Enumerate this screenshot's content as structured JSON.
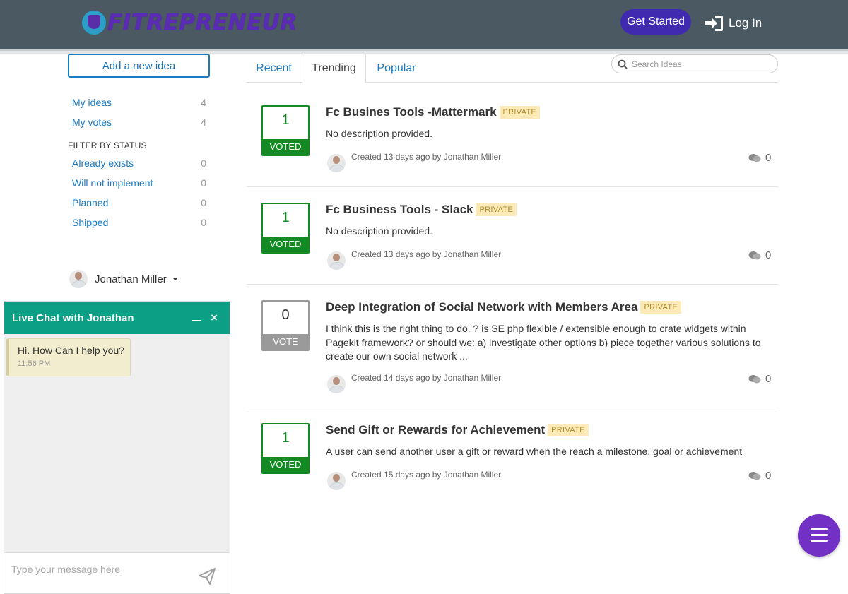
{
  "header": {
    "logo_text": "FITREPRENEUR",
    "get_started": "Get Started",
    "login": "Log In",
    "colors": {
      "bar": "#4b5962",
      "accent": "#3f2ab0"
    }
  },
  "sidebar": {
    "add_idea": "Add a new idea",
    "links": [
      {
        "label": "My ideas",
        "count": "4"
      },
      {
        "label": "My votes",
        "count": "4"
      }
    ],
    "filter_title": "FILTER BY STATUS",
    "statuses": [
      {
        "label": "Already exists",
        "count": "0"
      },
      {
        "label": "Will not implement",
        "count": "0"
      },
      {
        "label": "Planned",
        "count": "0"
      },
      {
        "label": "Shipped",
        "count": "0"
      }
    ],
    "user_name": "Jonathan Miller"
  },
  "chat": {
    "title": "Live Chat with Jonathan",
    "minimize_icon": "minimize-icon",
    "close_icon": "×",
    "message": "Hi. How Can I help you?",
    "time": "11:56 PM",
    "input_placeholder": "Type your message here",
    "color": "#0d9e86"
  },
  "tabs": [
    {
      "label": "Recent",
      "active": false
    },
    {
      "label": "Trending",
      "active": true
    },
    {
      "label": "Popular",
      "active": false
    }
  ],
  "search": {
    "placeholder": "Search Ideas"
  },
  "ideas": [
    {
      "votes": "1",
      "vote_label": "VOTED",
      "title": "Fc Busines Tools -Mattermark",
      "badge": "PRIVATE",
      "description": "No description provided.",
      "meta": "Created 13 days ago by Jonathan Miller",
      "comments": "0"
    },
    {
      "votes": "1",
      "vote_label": "VOTED",
      "title": "Fc Business Tools - Slack",
      "badge": "PRIVATE",
      "description": "No description provided.",
      "meta": "Created 13 days ago by Jonathan Miller",
      "comments": "0"
    },
    {
      "votes": "0",
      "vote_label": "VOTE",
      "title": "Deep Integration of Social Network with Members Area",
      "badge": "PRIVATE",
      "description": "I think this is the right thing to do. ? is SE php flexible / extensible enough to crate widgets within Pagekit framework? or should we: a) investigate other options b) piece together various solutions to create our own social network ...",
      "meta": "Created 14 days ago by Jonathan Miller",
      "comments": "0"
    },
    {
      "votes": "1",
      "vote_label": "VOTED",
      "title": "Send Gift or Rewards for Achievement",
      "badge": "PRIVATE",
      "description": "A user can send another user a gift or reward when the reach a milestone, goal or achievement",
      "meta": "Created 15 days ago by Jonathan Miller",
      "comments": "0"
    }
  ],
  "fab": {
    "icon": "menu-icon",
    "color": "#7230c5"
  }
}
